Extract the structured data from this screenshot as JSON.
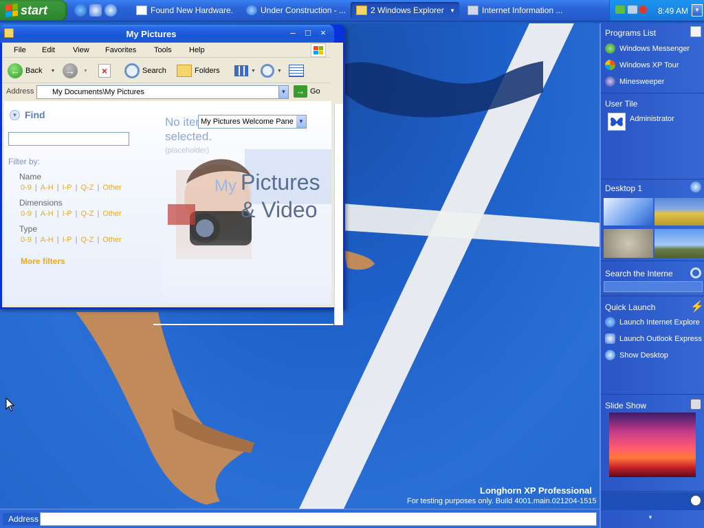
{
  "taskbar": {
    "start_label": "start",
    "tasks": [
      {
        "label": "Found New Hardware..."
      },
      {
        "label": "Under Construction - ..."
      },
      {
        "label": "2 Windows Explorer"
      },
      {
        "label": "Internet Information ..."
      }
    ],
    "clock": "8:49 AM"
  },
  "explorer": {
    "title": "My Pictures",
    "menu": [
      "File",
      "Edit",
      "View",
      "Favorites",
      "Tools",
      "Help"
    ],
    "toolbar": {
      "back": "Back",
      "search": "Search",
      "folders": "Folders"
    },
    "address_label": "Address",
    "address_value": "My Documents\\My Pictures",
    "go_label": "Go",
    "find": {
      "title": "Find",
      "filter_by": "Filter by:",
      "groups": [
        {
          "title": "Name",
          "options": [
            "0-9",
            "A-H",
            "I-P",
            "Q-Z",
            "Other"
          ]
        },
        {
          "title": "Dimensions",
          "options": [
            "0-9",
            "A-H",
            "I-P",
            "Q-Z",
            "Other"
          ]
        },
        {
          "title": "Type",
          "options": [
            "0-9",
            "A-H",
            "I-P",
            "Q-Z",
            "Other"
          ]
        }
      ],
      "more_filters": "More filters"
    },
    "preview": {
      "no_items_1": "No items",
      "no_items_2": "selected.",
      "placeholder": "(placeholder)",
      "pane_select": "My Pictures Welcome Pane",
      "brand_my": "My",
      "brand_pictures": "Pictures",
      "brand_video": "& Video"
    }
  },
  "sidebar": {
    "programs_title": "Programs List",
    "programs": [
      "Windows Messenger",
      "Windows XP Tour",
      "Minesweeper"
    ],
    "user_title": "User Tile",
    "user_name": "Administrator",
    "desktop_title": "Desktop 1",
    "search_title": "Search the Interne",
    "quick_title": "Quick Launch",
    "quick_items": [
      "Launch Internet Explore",
      "Launch Outlook Express",
      "Show Desktop"
    ],
    "slideshow_title": "Slide Show"
  },
  "bottombar": {
    "address_label": "Address"
  },
  "watermark": {
    "title": "Longhorn XP Professional",
    "subtitle": "For testing purposes only. Build 4001.main.021204-1515"
  }
}
